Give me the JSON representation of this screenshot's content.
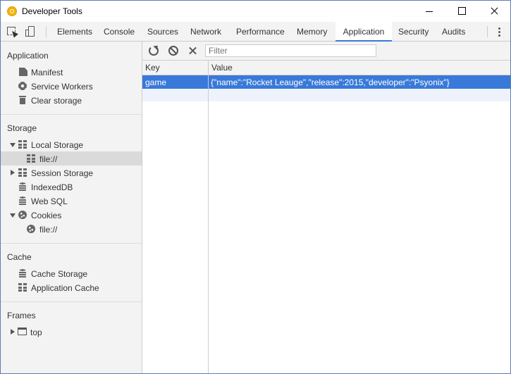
{
  "window": {
    "title": "Developer Tools"
  },
  "tabs": [
    {
      "label": "Elements"
    },
    {
      "label": "Console"
    },
    {
      "label": "Sources"
    },
    {
      "label": "Network"
    },
    {
      "label": "Performance"
    },
    {
      "label": "Memory"
    },
    {
      "label": "Application",
      "active": true
    },
    {
      "label": "Security"
    },
    {
      "label": "Audits"
    }
  ],
  "sidebar": {
    "application": {
      "title": "Application",
      "items": [
        "Manifest",
        "Service Workers",
        "Clear storage"
      ]
    },
    "storage": {
      "title": "Storage",
      "local_storage": "Local Storage",
      "local_file": "file://",
      "session_storage": "Session Storage",
      "indexeddb": "IndexedDB",
      "websql": "Web SQL",
      "cookies": "Cookies",
      "cookies_file": "file://"
    },
    "cache": {
      "title": "Cache",
      "items": [
        "Cache Storage",
        "Application Cache"
      ]
    },
    "frames": {
      "title": "Frames",
      "top": "top"
    }
  },
  "toolbar": {
    "filter_placeholder": "Filter"
  },
  "table": {
    "headers": {
      "key": "Key",
      "value": "Value"
    },
    "rows": [
      {
        "key": "game",
        "value": "{\"name\":\"Rocket Leauge\",\"release\":2015,\"developer\":\"Psyonix\"}"
      }
    ]
  },
  "colors": {
    "selection": "#3879d9",
    "active_tab_underline": "#3879d9"
  }
}
